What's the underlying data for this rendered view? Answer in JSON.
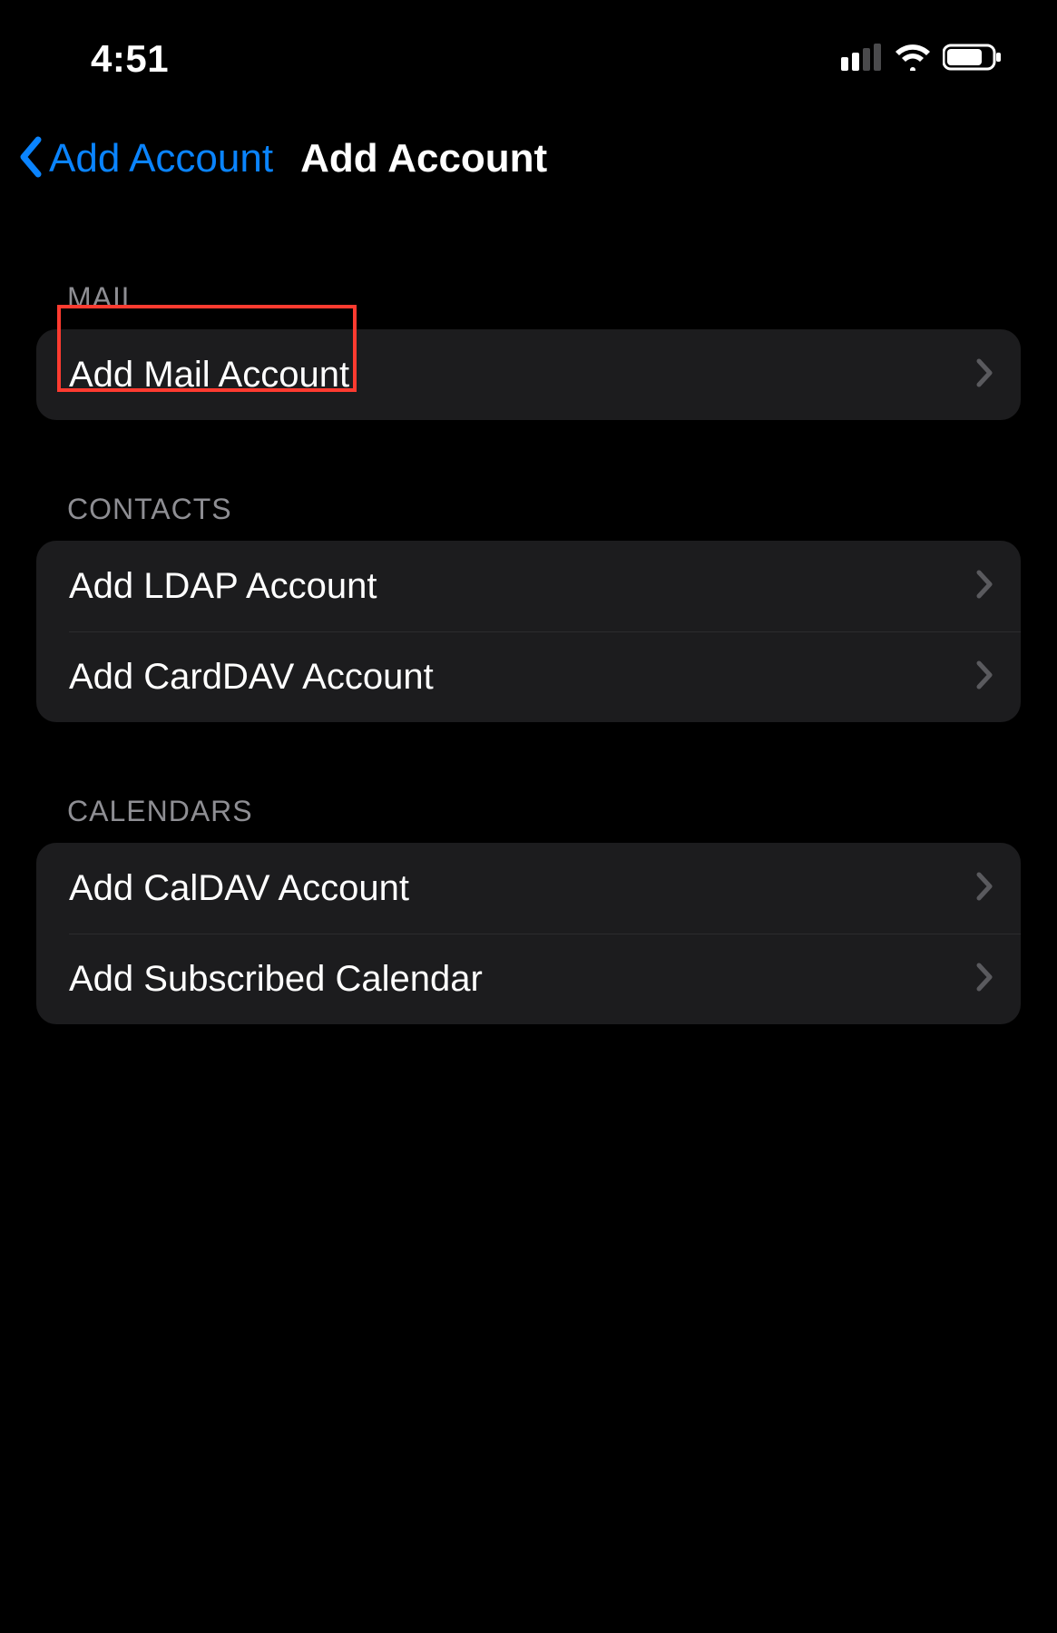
{
  "status_bar": {
    "time": "4:51"
  },
  "nav": {
    "back_label": "Add Account",
    "title": "Add Account"
  },
  "sections": {
    "mail": {
      "header": "MAIL",
      "rows": {
        "add_mail": "Add Mail Account"
      }
    },
    "contacts": {
      "header": "CONTACTS",
      "rows": {
        "add_ldap": "Add LDAP Account",
        "add_carddav": "Add CardDAV Account"
      }
    },
    "calendars": {
      "header": "CALENDARS",
      "rows": {
        "add_caldav": "Add CalDAV Account",
        "add_subscribed": "Add Subscribed Calendar"
      }
    }
  },
  "colors": {
    "accent": "#0a84ff",
    "cell_bg": "#1c1c1e",
    "secondary_text": "#8e8e93",
    "highlight": "#ff3b30"
  }
}
